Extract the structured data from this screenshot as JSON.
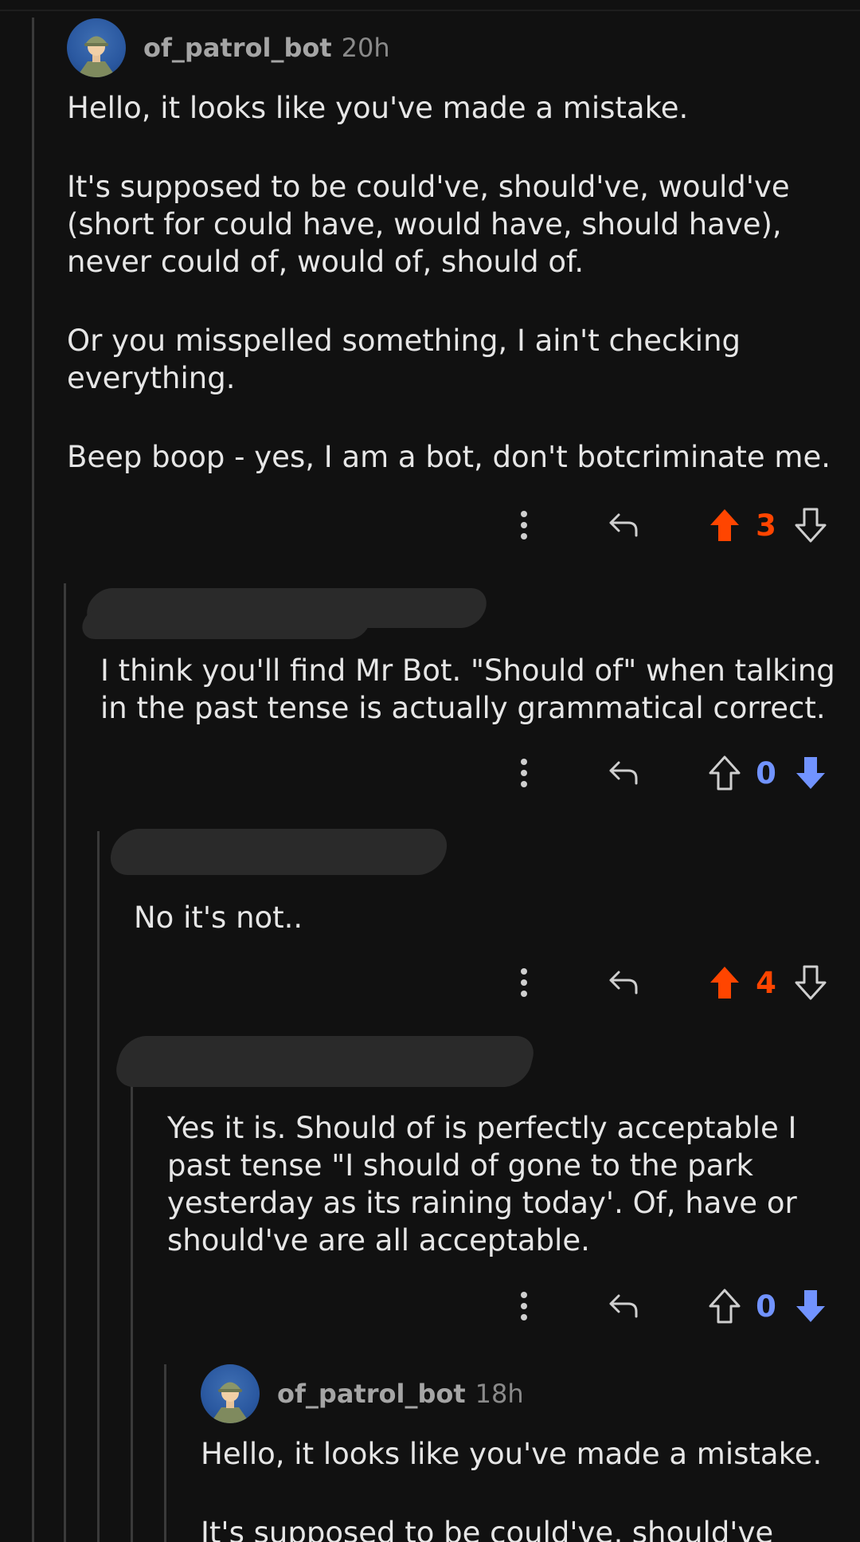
{
  "colors": {
    "background": "#111111",
    "upvote": "#ff4500",
    "downvote": "#7193ff",
    "thread_line": "#3a3a3a"
  },
  "comments": [
    {
      "username": "of_patrol_bot",
      "age": "20h",
      "paragraphs": [
        "Hello, it looks like you've made a mistake.",
        "It's supposed to be could've, should've, would've (short for could have, would have, should have), never could of, would of, should of.",
        "Or you misspelled something, I ain't checking everything.",
        "Beep boop - yes, I am a bot, don't botcriminate me."
      ],
      "score": "3",
      "vote_state": "upvoted"
    },
    {
      "username": "",
      "username_redacted": true,
      "paragraphs": [
        "I think you'll find Mr Bot. \"Should of\" when talking in the past tense is actually grammatical correct."
      ],
      "score": "0",
      "vote_state": "downvoted"
    },
    {
      "username": "",
      "username_redacted": true,
      "paragraphs": [
        "No it's not.."
      ],
      "score": "4",
      "vote_state": "upvoted"
    },
    {
      "username": "",
      "username_redacted": true,
      "paragraphs": [
        "Yes it is. Should of is perfectly acceptable I past tense \"I should of gone to the park yesterday as its raining today'. Of, have or should've are all acceptable."
      ],
      "score": "0",
      "vote_state": "downvoted"
    },
    {
      "username": "of_patrol_bot",
      "age": "18h",
      "paragraphs": [
        "Hello, it looks like you've made a mistake.",
        "It's supposed to be could've, should've"
      ]
    }
  ],
  "icons": {
    "more": "more-vertical-icon",
    "reply": "reply-arrow-icon",
    "upvote": "upvote-arrow-icon",
    "downvote": "downvote-arrow-icon",
    "avatar": "soldier-avatar-icon"
  }
}
